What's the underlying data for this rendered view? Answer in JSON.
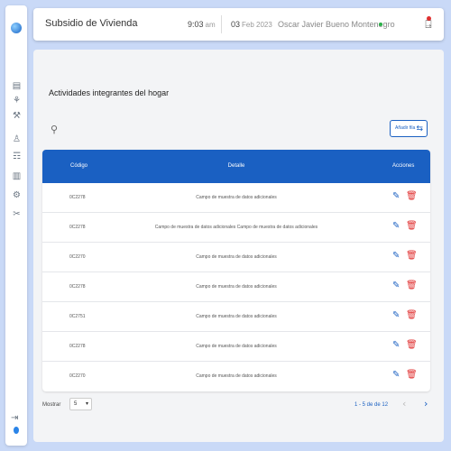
{
  "app": {
    "title": "Subsidio de Vivienda",
    "time": "9:03",
    "time_period": "am",
    "date_day": "03",
    "date_rest": "Feb 2023",
    "user_name": "Oscar Javier Bueno Montenegro"
  },
  "icons": {
    "sidebar": [
      "▤",
      "⚘",
      "⚒",
      "♙",
      "☶",
      "▥",
      "⚙",
      "✂"
    ],
    "sidebar_names": [
      "dashboard-icon",
      "family-icon",
      "tools-icon",
      "person-icon",
      "documents-icon",
      "grid-icon",
      "settings-icon",
      "cut-icon"
    ],
    "exit": "⇥",
    "logout": "⍈",
    "search": "⚲",
    "add": "⇆",
    "edit": "✎",
    "delete": "🗑",
    "chevron_down": "▾",
    "prev": "‹",
    "next": "›"
  },
  "page": {
    "section_title": "Actividades integrantes del hogar",
    "add_button": "Añadir fila"
  },
  "table": {
    "columns": [
      "Código",
      "Detalle",
      "Acciones"
    ],
    "rows": [
      {
        "code": "0C2278",
        "detail": "Campo de muestra de datos adicionales"
      },
      {
        "code": "0C2278",
        "detail": "Campo de muestra de datos adicionales Campo de muestra de datos adicionales"
      },
      {
        "code": "0C2270",
        "detail": "Campo de muestra de datos adicionales"
      },
      {
        "code": "0C2278",
        "detail": "Campo de muestra de datos adicionales"
      },
      {
        "code": "0C2751",
        "detail": "Campo de muestra de datos adicionales"
      },
      {
        "code": "0C2278",
        "detail": "Campo de muestra de datos adicionales"
      },
      {
        "code": "0C2270",
        "detail": "Campo de muestra de datos adicionales"
      }
    ]
  },
  "pagination": {
    "label": "Mostrar",
    "page_size": "5",
    "range": "1 - 5 de de 12"
  },
  "colors": {
    "primary": "#1a60c2",
    "background": "#c9d9f7",
    "delete": "#e03030",
    "online": "#2cb34a"
  }
}
